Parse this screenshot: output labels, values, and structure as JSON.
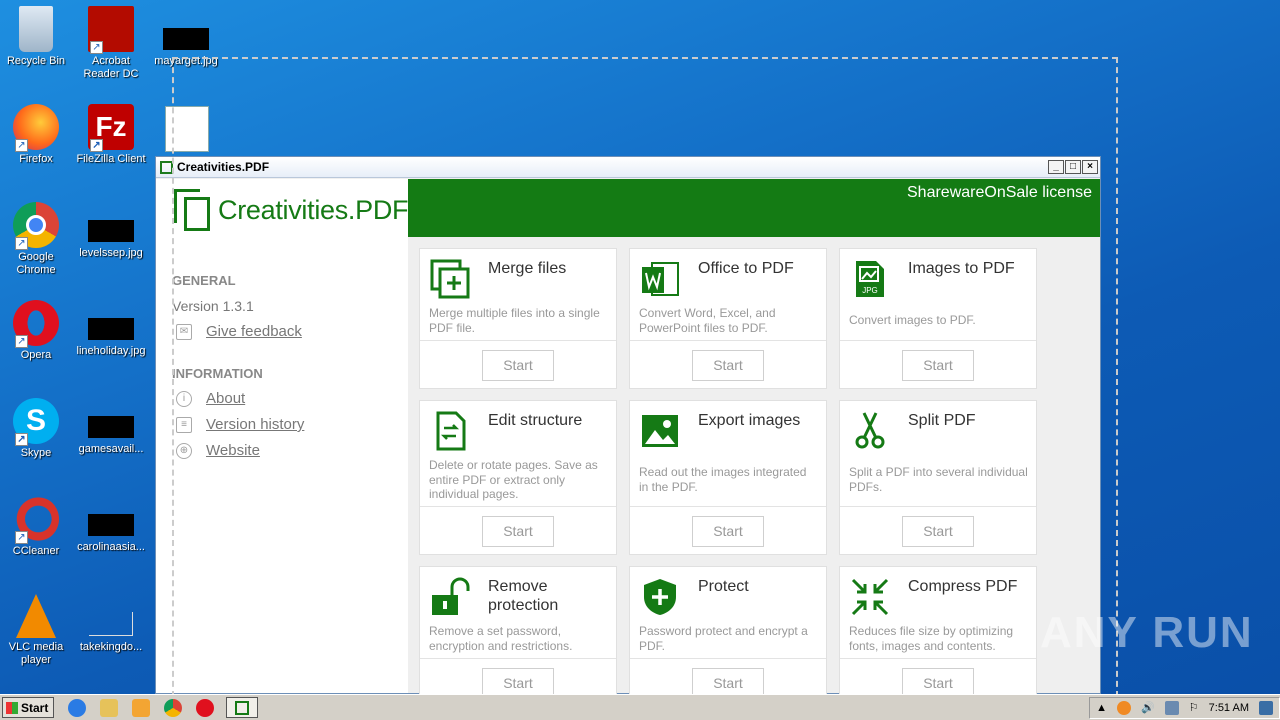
{
  "desktop": {
    "icons": [
      {
        "label": "Recycle Bin"
      },
      {
        "label": "Acrobat Reader DC"
      },
      {
        "label": "mayarget.jpg"
      },
      {
        "label": "Firefox"
      },
      {
        "label": "FileZilla Client"
      },
      {
        "label": "Google Chrome"
      },
      {
        "label": "levelssep.jpg"
      },
      {
        "label": "Opera"
      },
      {
        "label": "lineholiday.jpg"
      },
      {
        "label": "Skype"
      },
      {
        "label": "gamesavail..."
      },
      {
        "label": "CCleaner"
      },
      {
        "label": "carolinaasia..."
      },
      {
        "label": "VLC media player"
      },
      {
        "label": "takekingdo..."
      }
    ]
  },
  "window": {
    "title": "Creativities.PDF",
    "license": "SharewareOnSale license",
    "logo_text": "Creativities.PDF",
    "sidebar": {
      "general_heading": "GENERAL",
      "version": "Version 1.3.1",
      "feedback": "Give feedback",
      "information_heading": "INFORMATION",
      "about": "About",
      "version_history": "Version history",
      "website": "Website"
    },
    "cards": [
      {
        "title": "Merge files",
        "desc": "Merge multiple files into a single PDF file.",
        "button": "Start"
      },
      {
        "title": "Office to PDF",
        "desc": "Convert Word, Excel, and PowerPoint files to PDF.",
        "button": "Start"
      },
      {
        "title": "Images to PDF",
        "desc": "Convert images to PDF.",
        "button": "Start"
      },
      {
        "title": "Edit structure",
        "desc": "Delete or rotate pages. Save as entire PDF or extract only individual pages.",
        "button": "Start"
      },
      {
        "title": "Export images",
        "desc": "Read out the images integrated in the PDF.",
        "button": "Start"
      },
      {
        "title": "Split PDF",
        "desc": "Split a PDF into several individual PDFs.",
        "button": "Start"
      },
      {
        "title": "Remove protection",
        "desc": "Remove a set password, encryption and restrictions.",
        "button": "Start"
      },
      {
        "title": "Protect",
        "desc": "Password protect and encrypt a PDF.",
        "button": "Start"
      },
      {
        "title": "Compress PDF",
        "desc": "Reduces file size by optimizing fonts, images and contents.",
        "button": "Start"
      }
    ]
  },
  "taskbar": {
    "start_label": "Start",
    "clock": "7:51 AM"
  },
  "watermark": "ANY RUN",
  "colors": {
    "accent": "#147b14"
  }
}
